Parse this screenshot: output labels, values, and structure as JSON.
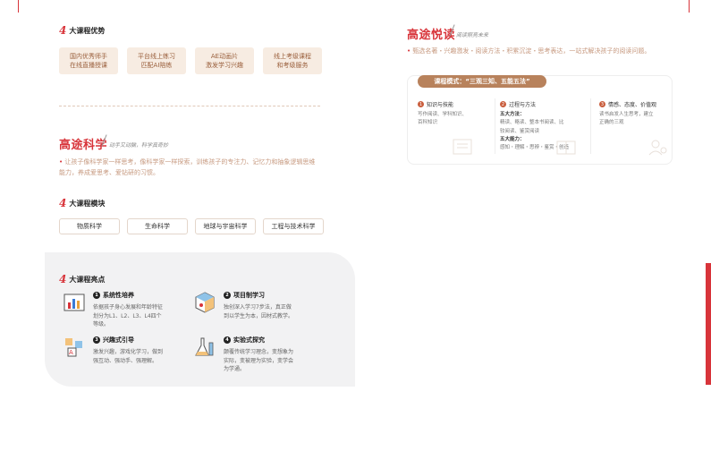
{
  "advantages": {
    "heading_num": "4",
    "heading": "大课程优势",
    "items": [
      "国内优秀师手\n在线直播授课",
      "平台线上练习\n匹配AI陪练",
      "AE动画片\n激发学习兴趣",
      "线上考级课程\n和考级服务"
    ]
  },
  "science": {
    "title": "高途科学",
    "subtitle": "动手又动脑，科学真奇妙",
    "desc": "让孩子像科学家一样思考，像科学家一样探索，训练孩子的专注力、记忆力和抽象逻辑思维能力，养成爱思考、爱钻研的习惯。",
    "modules_num": "4",
    "modules_heading": "大课程模块",
    "modules": [
      "物质科学",
      "生命科学",
      "地球与宇宙科学",
      "工程与技术科学"
    ]
  },
  "highlights": {
    "heading_num": "4",
    "heading": "大课程亮点",
    "items": [
      {
        "num": "1",
        "title": "系统性培养",
        "desc": "依据孩子身心发展和年龄特征划分为L1、L2、L3、L4四个等级。",
        "icon": "bar-chart-icon"
      },
      {
        "num": "2",
        "title": "项目制学习",
        "desc": "独创深入学习7步法，真正做到以学生为本，因材式教学。",
        "icon": "cube-icon"
      },
      {
        "num": "3",
        "title": "兴趣式引导",
        "desc": "激发兴趣，游戏化学习，做到强互动、强动手、强理解。",
        "icon": "abc-icon"
      },
      {
        "num": "4",
        "title": "实验式探究",
        "desc": "颠覆传统学习理念，变想象为实际，变被理为实验，变学会为学通。",
        "icon": "flask-icon"
      }
    ]
  },
  "reading": {
    "title": "高途悦读",
    "subtitle": "阅读照亮未来",
    "desc": "甄选名著・兴趣激发・阅读方法・积累沉淀・思考表达，一站式解决孩子的阅读问题。",
    "mode_label": "课程模式：“三观三知、五能五法”",
    "columns": [
      {
        "num": "1",
        "title": "知识与技能",
        "lines": [
          "写作阅读、学科知识、",
          "百科知识"
        ]
      },
      {
        "num": "2",
        "title": "过程与方法",
        "lines": [
          "五大方法：",
          "精读、略读、整本书阅读、比",
          "较阅读、鉴赏阅读",
          "五大能力：",
          "感知・理解・思辨・鉴赏・创造"
        ]
      },
      {
        "num": "3",
        "title": "情感、态度、价值观",
        "lines": [
          "读书启发人生思考，建立",
          "正确的三观"
        ]
      }
    ]
  },
  "colors": {
    "accent": "#d8343a",
    "brand_brown": "#b8825c",
    "chip_bg": "#f7ece2"
  }
}
